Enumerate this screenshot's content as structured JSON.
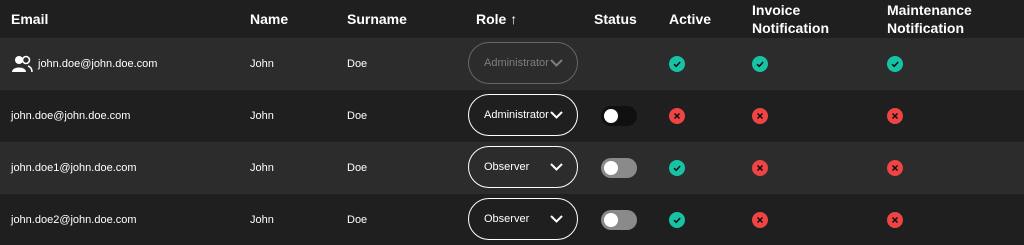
{
  "headers": {
    "email": "Email",
    "name": "Name",
    "surname": "Surname",
    "role": "Role ↑",
    "status": "Status",
    "active": "Active",
    "invoice_line1": "Invoice",
    "invoice_line2": "Notification",
    "maintenance_line1": "Maintenance",
    "maintenance_line2": "Notification"
  },
  "rows": [
    {
      "email": "john.doe@john.doe.com",
      "name": "John",
      "surname": "Doe",
      "role": "Administrator",
      "role_disabled": true,
      "status": null,
      "active": true,
      "invoice": true,
      "maintenance": true,
      "icon": "users-icon"
    },
    {
      "email": "john.doe@john.doe.com",
      "name": "John",
      "surname": "Doe",
      "role": "Administrator",
      "role_disabled": false,
      "status": "off",
      "active": false,
      "invoice": false,
      "maintenance": false
    },
    {
      "email": "john.doe1@john.doe.com",
      "name": "John",
      "surname": "Doe",
      "role": "Observer",
      "role_disabled": false,
      "status": "off",
      "active": true,
      "invoice": false,
      "maintenance": false
    },
    {
      "email": "john.doe2@john.doe.com",
      "name": "John",
      "surname": "Doe",
      "role": "Observer",
      "role_disabled": false,
      "status": "off",
      "active": true,
      "invoice": false,
      "maintenance": false
    }
  ],
  "colors": {
    "success": "#16c3a4",
    "error": "#ef4444",
    "row_alt": "#2c2c2c",
    "background": "#1f1f1f"
  }
}
